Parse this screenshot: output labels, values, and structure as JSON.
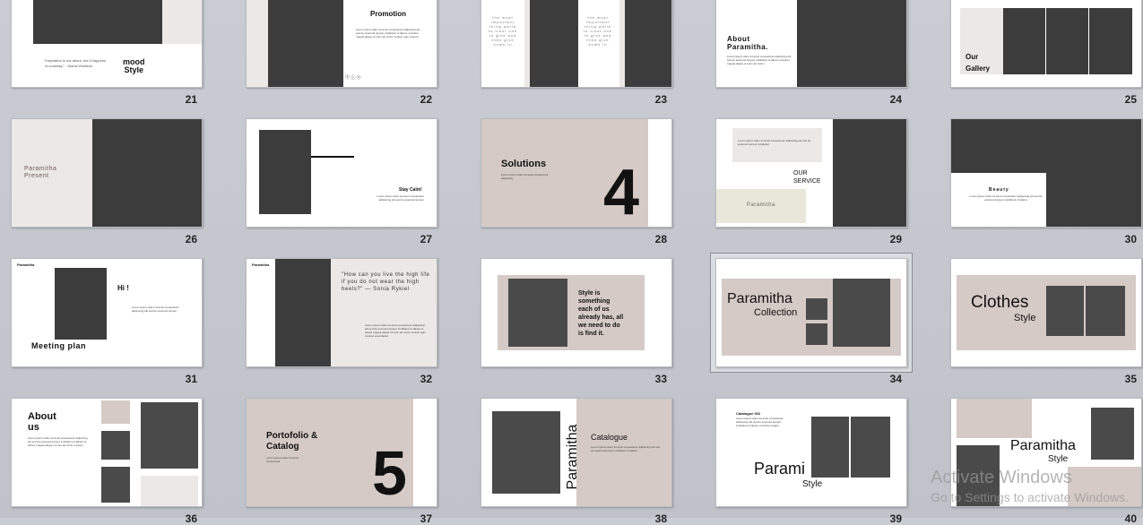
{
  "slide_numbers": [
    "21",
    "22",
    "23",
    "24",
    "25",
    "26",
    "27",
    "28",
    "29",
    "30",
    "31",
    "32",
    "33",
    "34",
    "35",
    "36",
    "37",
    "38",
    "39",
    "40"
  ],
  "slides": {
    "s21": {
      "title": "mood\nStyle",
      "quote": "\"Inspiration is not about, but it happens\n of courtesy.\" - Diana Vreeland"
    },
    "s22": {
      "title": "Promotion",
      "social": "ⓕ ⓘ ⓣ"
    },
    "s23": {
      "quote_left": "the most\nimportant\nthing while\nto trust one\nto give and\nthen give\nsome in",
      "quote_right": "the most\nimportant\nthing while\nto trust one\nto give and\nthen give\nsome in"
    },
    "s24": {
      "title": "About\nParamitha."
    },
    "s25": {
      "title": "Our\nGallery"
    },
    "s26": {
      "title": "Paramitha\nPresent"
    },
    "s27": {
      "title": "Stay Calm!"
    },
    "s28": {
      "title": "Solutions",
      "number": "4"
    },
    "s29": {
      "title": "OUR\nSERVICE",
      "label": "Paramitha"
    },
    "s30": {
      "title": "Beauty"
    },
    "s31": {
      "brand": "Paramitha",
      "greeting": "Hi !",
      "title": "Meeting plan"
    },
    "s32": {
      "brand": "Paramitha",
      "quote": "\"How can you live the high life if you do not wear the high heels?\" — Sonia Rykiel"
    },
    "s33": {
      "text": "Style is\nsomething\neach of us\nalready has, all\nwe need to do\nis find it."
    },
    "s34": {
      "title": "Paramitha",
      "subtitle": "Collection"
    },
    "s35": {
      "title": "Clothes",
      "subtitle": "Style"
    },
    "s36": {
      "title": "About\nus"
    },
    "s37": {
      "title": "Portofolio &\nCatalog",
      "number": "5"
    },
    "s38": {
      "vertical": "Paramitha",
      "title": "Catalogue"
    },
    "s39": {
      "header": "Catalogue 002",
      "title": "Parami",
      "subtitle": "Style"
    },
    "s40": {
      "title": "Paramitha",
      "subtitle": "Style"
    }
  },
  "watermark": {
    "line1": "Activate Windows",
    "line2": "Go to Settings to activate Windows."
  }
}
